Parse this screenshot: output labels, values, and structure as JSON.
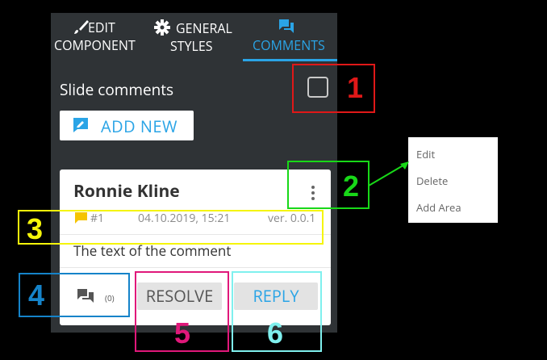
{
  "tabs": {
    "edit_line1": "EDIT",
    "edit_line2": "COMPONENT",
    "general_line1": "GENERAL",
    "general_line2": "STYLES",
    "comments": "COMMENTS"
  },
  "panel": {
    "title": "Slide comments",
    "add_new": "ADD NEW"
  },
  "comment": {
    "author": "Ronnie Kline",
    "number": "#1",
    "datetime": "04.10.2019, 15:21",
    "version": "ver. 0.0.1",
    "text": "The text of the comment",
    "reply_count": "(0)",
    "resolve": "RESOLVE",
    "reply": "REPLY"
  },
  "menu": [
    "Edit",
    "Delete",
    "Add Area"
  ],
  "annotations": [
    "1",
    "2",
    "3",
    "4",
    "5",
    "6"
  ],
  "colors": {
    "accent": "#2aa4e6",
    "panel_bg": "#2f3336",
    "ann1": "#e01818",
    "ann2": "#18d818",
    "ann3": "#f5f50a",
    "ann4": "#1583c9",
    "ann5": "#e0187a",
    "ann6": "#7ff0ee"
  }
}
